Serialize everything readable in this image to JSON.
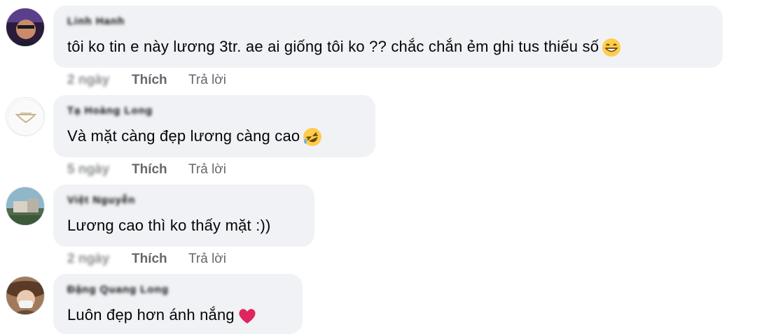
{
  "comments": [
    {
      "author": "Linh Hanh",
      "text": "tôi ko tin e này lương 3tr. ae ai giống tôi ko ?? chắc chắn ẻm ghi tus thiếu số",
      "emoji": "grinning-face-icon",
      "time": "2 ngày",
      "like_label": "Thích",
      "reply_label": "Trả lời"
    },
    {
      "author": "Tạ Hoàng Long",
      "text": "Và mặt càng đẹp lương càng cao",
      "emoji": "rolling-laughing-face-icon",
      "time": "5 ngày",
      "like_label": "Thích",
      "reply_label": "Trả lời"
    },
    {
      "author": "Việt Nguyễn",
      "text": "Lương cao thì ko thấy mặt :))",
      "emoji": "",
      "time": "2 ngày",
      "like_label": "Thích",
      "reply_label": "Trả lời"
    },
    {
      "author": "Đặng Quang Long",
      "text": "Luôn đẹp hơn ánh nắng",
      "emoji": "red-heart-icon",
      "time": "",
      "like_label": "",
      "reply_label": ""
    }
  ],
  "colors": {
    "bubble": "#f0f2f5",
    "text": "#050505",
    "muted": "#65676b",
    "heart": "#e0245e",
    "emoji_yellow": "#ffcc4d"
  }
}
